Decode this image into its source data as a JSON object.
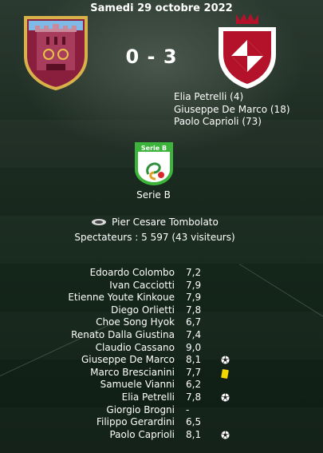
{
  "match": {
    "date": "Samedi 29 octobre 2022",
    "score": "0 - 3",
    "home_crest": "cittadella-crest-icon",
    "away_crest": "sudtirol-crest-icon",
    "scorers": [
      "Elia Petrelli (4)",
      "Giuseppe De Marco (18)",
      "Paolo Caprioli (73)"
    ]
  },
  "competition": {
    "name": "Serie B",
    "logo_text": "Serie B",
    "logo_icon": "serie-b-logo-icon"
  },
  "venue": {
    "stadium_icon": "stadium-icon",
    "stadium": "Pier Cesare Tombolato",
    "spectators": "Spectateurs : 5 597 (43 visiteurs)"
  },
  "players": [
    {
      "name": "Edoardo Colombo",
      "rating": "7,2",
      "event": ""
    },
    {
      "name": "Ivan Cacciotti",
      "rating": "7,9",
      "event": ""
    },
    {
      "name": "Etienne Youte Kinkoue",
      "rating": "7,9",
      "event": ""
    },
    {
      "name": "Diego Orlietti",
      "rating": "7,8",
      "event": ""
    },
    {
      "name": "Choe Song Hyok",
      "rating": "6,7",
      "event": ""
    },
    {
      "name": "Renato Dalla Giustina",
      "rating": "7,4",
      "event": ""
    },
    {
      "name": "Claudio Cassano",
      "rating": "9,0",
      "event": ""
    },
    {
      "name": "Giuseppe De Marco",
      "rating": "8,1",
      "event": "goal-icon"
    },
    {
      "name": "Marco Brescianini",
      "rating": "7,7",
      "event": "yellow-card-icon"
    },
    {
      "name": "Samuele Vianni",
      "rating": "6,2",
      "event": ""
    },
    {
      "name": "Elia Petrelli",
      "rating": "7,8",
      "event": "goal-icon"
    },
    {
      "name": "Giorgio Brogni",
      "rating": "-",
      "event": ""
    },
    {
      "name": "Filippo Gerardini",
      "rating": "6,5",
      "event": ""
    },
    {
      "name": "Paolo Caprioli",
      "rating": "8,1",
      "event": "goal-icon"
    }
  ],
  "colors": {
    "home_primary": "#8a1f3d",
    "home_secondary": "#e8c24a",
    "away_primary": "#b3122a",
    "serie_b_green": "#3cb43c",
    "yellow_card": "#f2d600"
  }
}
